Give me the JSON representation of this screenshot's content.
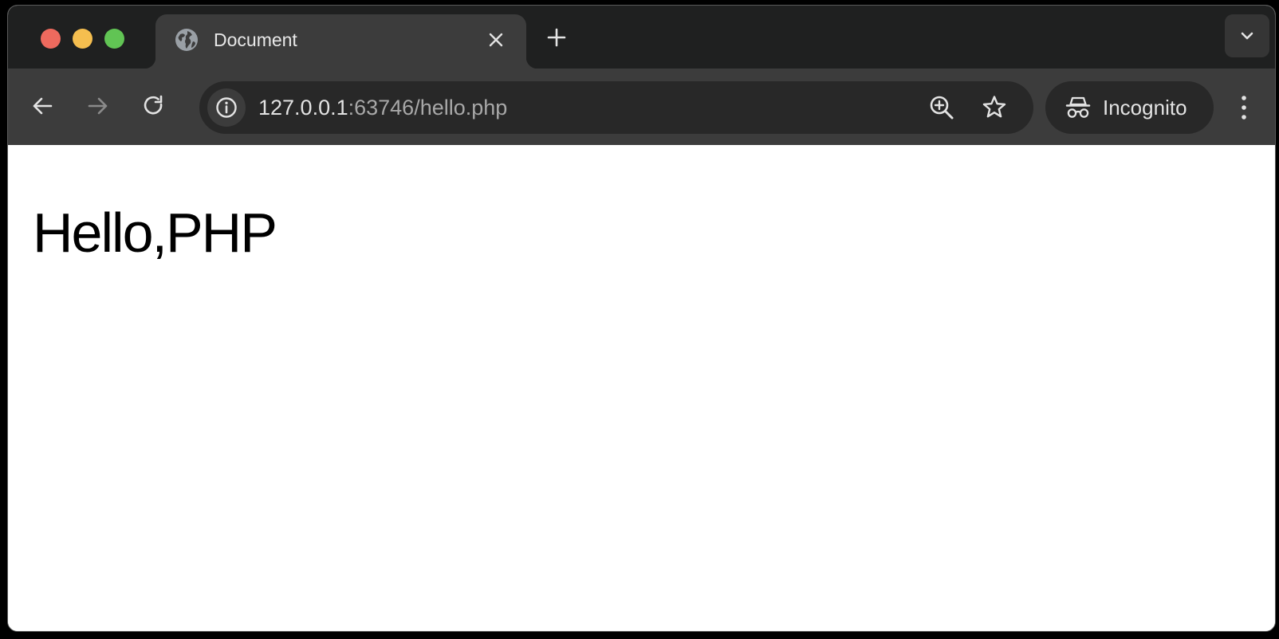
{
  "window": {
    "traffic_colors": {
      "close": "#ee6a5e",
      "minimize": "#f5be4f",
      "maximize": "#61c454"
    }
  },
  "tab": {
    "title": "Document",
    "favicon_icon": "globe-icon",
    "close_icon": "close-icon"
  },
  "tabstrip": {
    "new_tab_icon": "plus-icon",
    "tab_search_icon": "chevron-down-icon"
  },
  "toolbar": {
    "back_icon": "arrow-left-icon",
    "forward_icon": "arrow-right-icon",
    "reload_icon": "reload-icon",
    "url_host": "127.0.0.1",
    "url_path": ":63746/hello.php",
    "site_info_icon": "info-icon",
    "zoom_icon": "zoom-in-icon",
    "bookmark_icon": "star-icon",
    "incognito_label": "Incognito",
    "incognito_icon": "incognito-icon",
    "menu_icon": "kebab-menu-icon"
  },
  "page": {
    "heading": "Hello,PHP"
  }
}
